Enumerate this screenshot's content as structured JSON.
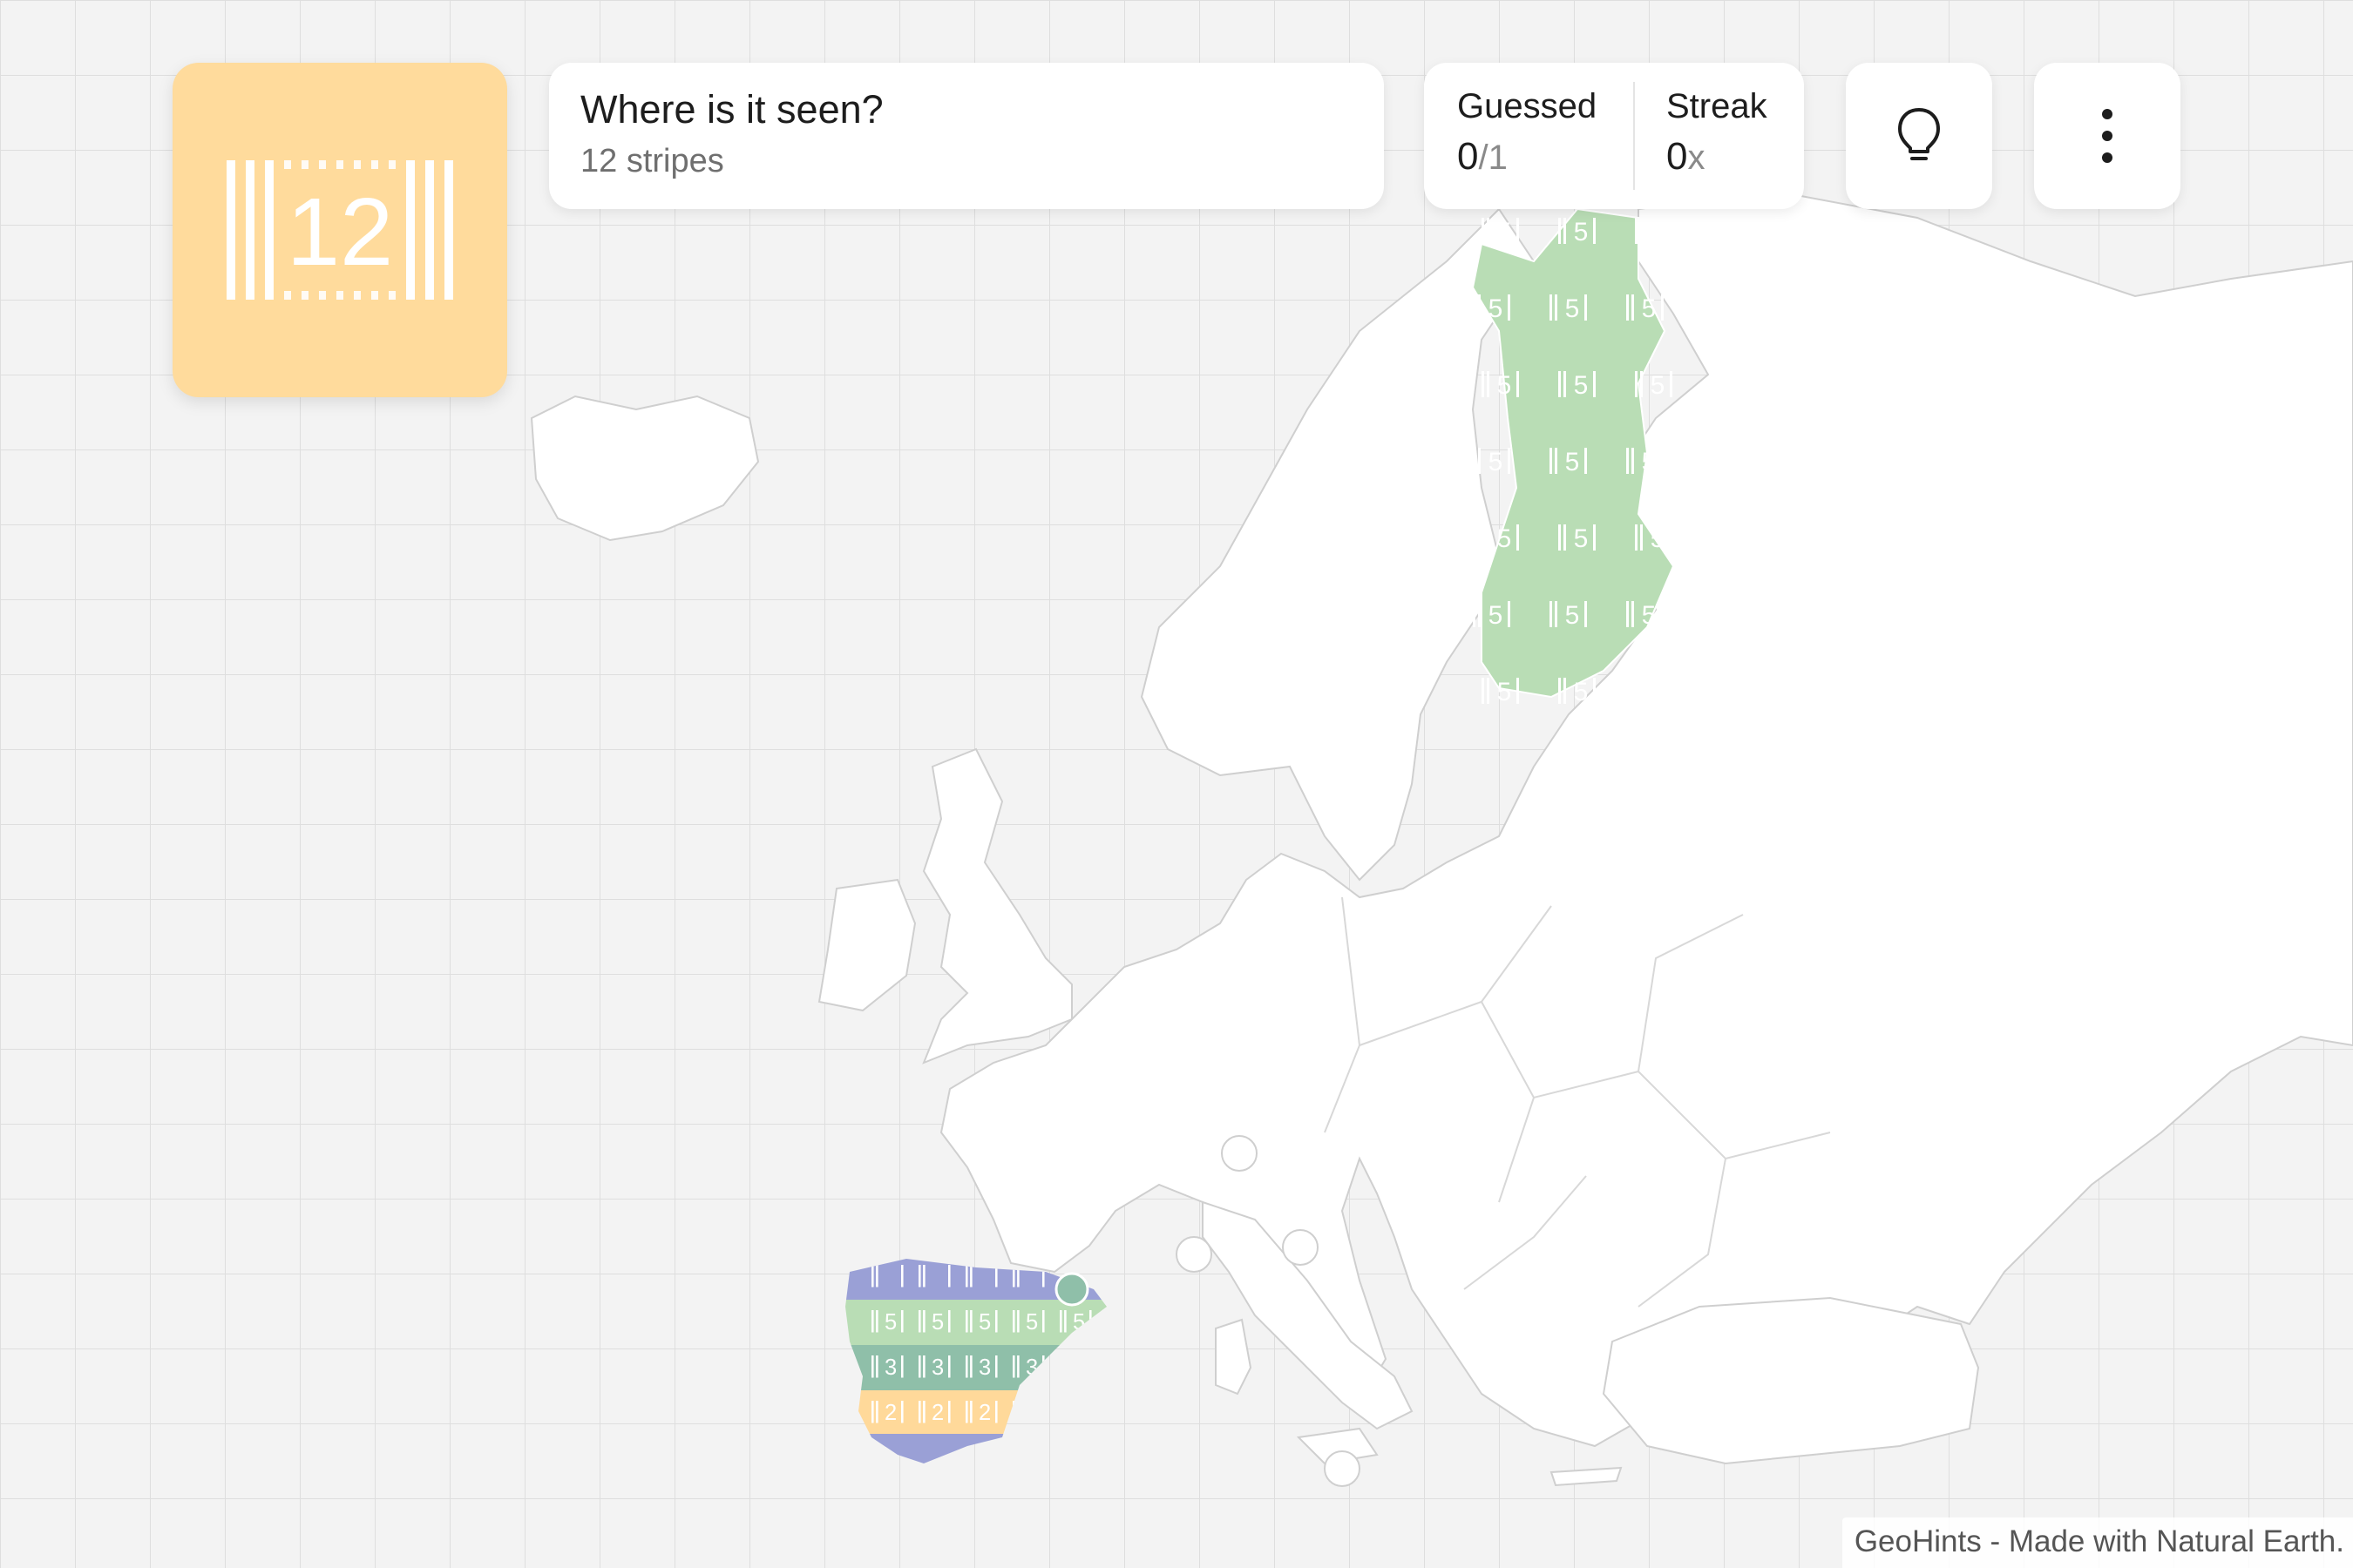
{
  "game": {
    "clue_number": "12",
    "question_title": "Where is it seen?",
    "question_subtitle": "12 stripes"
  },
  "stats": {
    "guessed_label": "Guessed",
    "guessed_value": "0",
    "guessed_total": "/1",
    "streak_label": "Streak",
    "streak_value": "0",
    "streak_suffix": "x"
  },
  "buttons": {
    "hint_icon": "lightbulb-icon",
    "menu_icon": "kebab-menu-icon"
  },
  "map": {
    "highlight_finland": "5",
    "highlight_spain_bands": [
      "",
      "5",
      "3",
      "2"
    ],
    "colors": {
      "tile": "#ffdb9c",
      "finland": "#b9ddb5",
      "spain_purple": "#9aa0d6",
      "spain_green": "#b9ddb5",
      "spain_teal": "#8fbfa9",
      "spain_yellow": "#ffd99a"
    }
  },
  "footer": {
    "credit": "GeoHints - Made with Natural Earth."
  }
}
